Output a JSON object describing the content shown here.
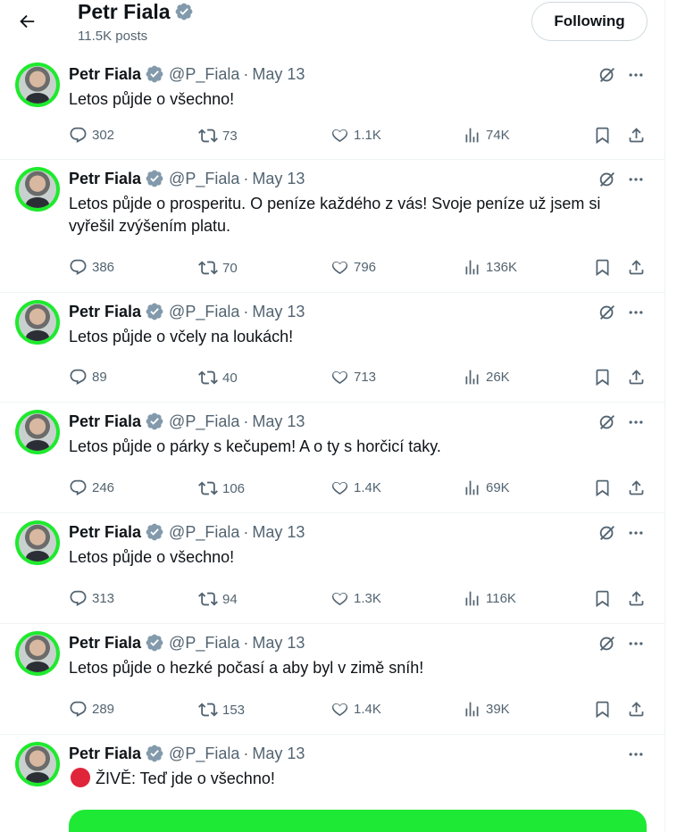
{
  "header": {
    "name": "Petr Fiala",
    "post_count": "11.5K posts",
    "follow_label": "Following"
  },
  "icons": {
    "back": "arrow-left-icon",
    "verified": "verified-badge-icon",
    "grok": "grok-icon",
    "more": "more-icon",
    "reply": "reply-icon",
    "retweet": "retweet-icon",
    "like": "heart-icon",
    "views": "views-icon",
    "bookmark": "bookmark-icon",
    "share": "share-icon"
  },
  "colors": {
    "avatar_ring": "#1eea2d",
    "green_card": "#1ee935",
    "live_dot": "#e0243a",
    "secondary_text": "#536471",
    "verified_badge": "#829aab"
  },
  "tweets": [
    {
      "name": "Petr Fiala",
      "handle": "@P_Fiala",
      "sep": "·",
      "date": "May 13",
      "text": "Letos půjde o všechno!",
      "replies": "302",
      "retweets": "73",
      "likes": "1.1K",
      "views": "74K"
    },
    {
      "name": "Petr Fiala",
      "handle": "@P_Fiala",
      "sep": "·",
      "date": "May 13",
      "text": "Letos půjde o prosperitu. O peníze každého z vás! Svoje peníze už jsem si vyřešil zvýšením platu.",
      "replies": "386",
      "retweets": "70",
      "likes": "796",
      "views": "136K"
    },
    {
      "name": "Petr Fiala",
      "handle": "@P_Fiala",
      "sep": "·",
      "date": "May 13",
      "text": "Letos půjde o včely na loukách!",
      "replies": "89",
      "retweets": "40",
      "likes": "713",
      "views": "26K"
    },
    {
      "name": "Petr Fiala",
      "handle": "@P_Fiala",
      "sep": "·",
      "date": "May 13",
      "text": "Letos půjde o párky s kečupem! A o ty s horčicí taky.",
      "replies": "246",
      "retweets": "106",
      "likes": "1.4K",
      "views": "69K"
    },
    {
      "name": "Petr Fiala",
      "handle": "@P_Fiala",
      "sep": "·",
      "date": "May 13",
      "text": "Letos půjde o všechno!",
      "replies": "313",
      "retweets": "94",
      "likes": "1.3K",
      "views": "116K"
    },
    {
      "name": "Petr Fiala",
      "handle": "@P_Fiala",
      "sep": "·",
      "date": "May 13",
      "text": "Letos půjde o hezké počasí a aby byl v zimě sníh!",
      "replies": "289",
      "retweets": "153",
      "likes": "1.4K",
      "views": "39K"
    },
    {
      "name": "Petr Fiala",
      "handle": "@P_Fiala",
      "sep": "·",
      "date": "May 13",
      "text": "ŽIVĚ: Teď jde o všechno!"
    }
  ]
}
